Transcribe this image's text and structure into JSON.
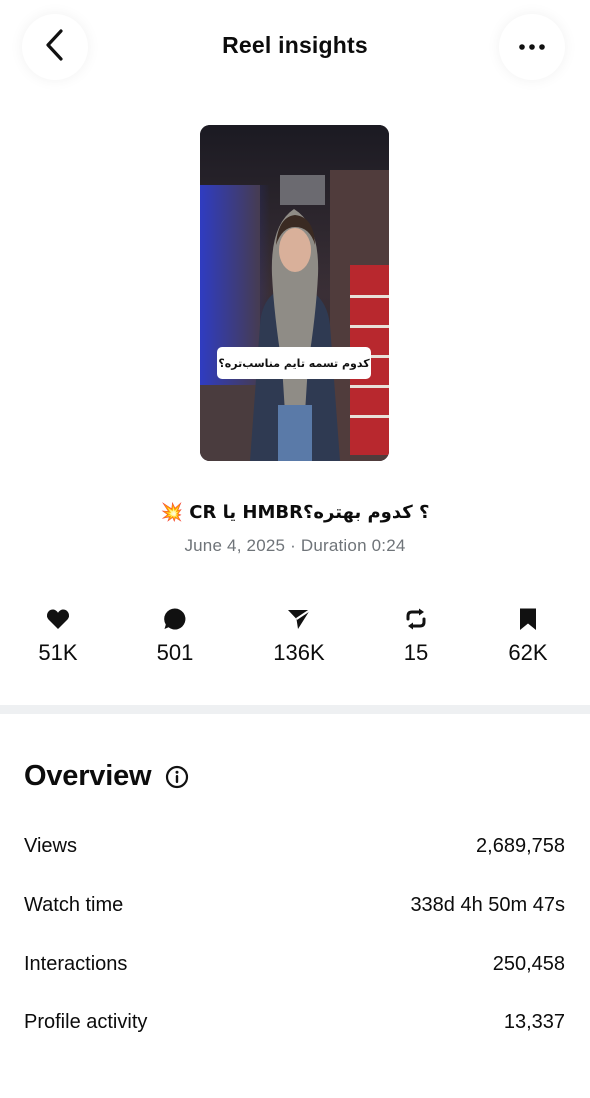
{
  "header": {
    "title": "Reel insights",
    "back_icon": "chevron-left-icon",
    "more_icon": "more-horizontal-icon"
  },
  "reel": {
    "thumbnail_caption": "کدوم تسمه تایم مناسب‌تره؟",
    "title": "؟ کدوم بهتره؟HMBR یا CR 💥",
    "meta": "June 4, 2025 · Duration 0:24"
  },
  "stats": [
    {
      "icon": "heart-icon",
      "value": "51K"
    },
    {
      "icon": "comment-icon",
      "value": "501"
    },
    {
      "icon": "share-icon",
      "value": "136K"
    },
    {
      "icon": "repost-icon",
      "value": "15"
    },
    {
      "icon": "bookmark-icon",
      "value": "62K"
    }
  ],
  "overview": {
    "title": "Overview",
    "info_icon": "info-icon",
    "metrics": [
      {
        "label": "Views",
        "value": "2,689,758"
      },
      {
        "label": "Watch time",
        "value": "338d 4h 50m 47s"
      },
      {
        "label": "Interactions",
        "value": "250,458"
      },
      {
        "label": "Profile activity",
        "value": "13,337"
      }
    ]
  },
  "colors": {
    "text": "#0c0c0c",
    "muted": "#6f7479",
    "divider": "#eef0f2",
    "background": "#ffffff"
  }
}
